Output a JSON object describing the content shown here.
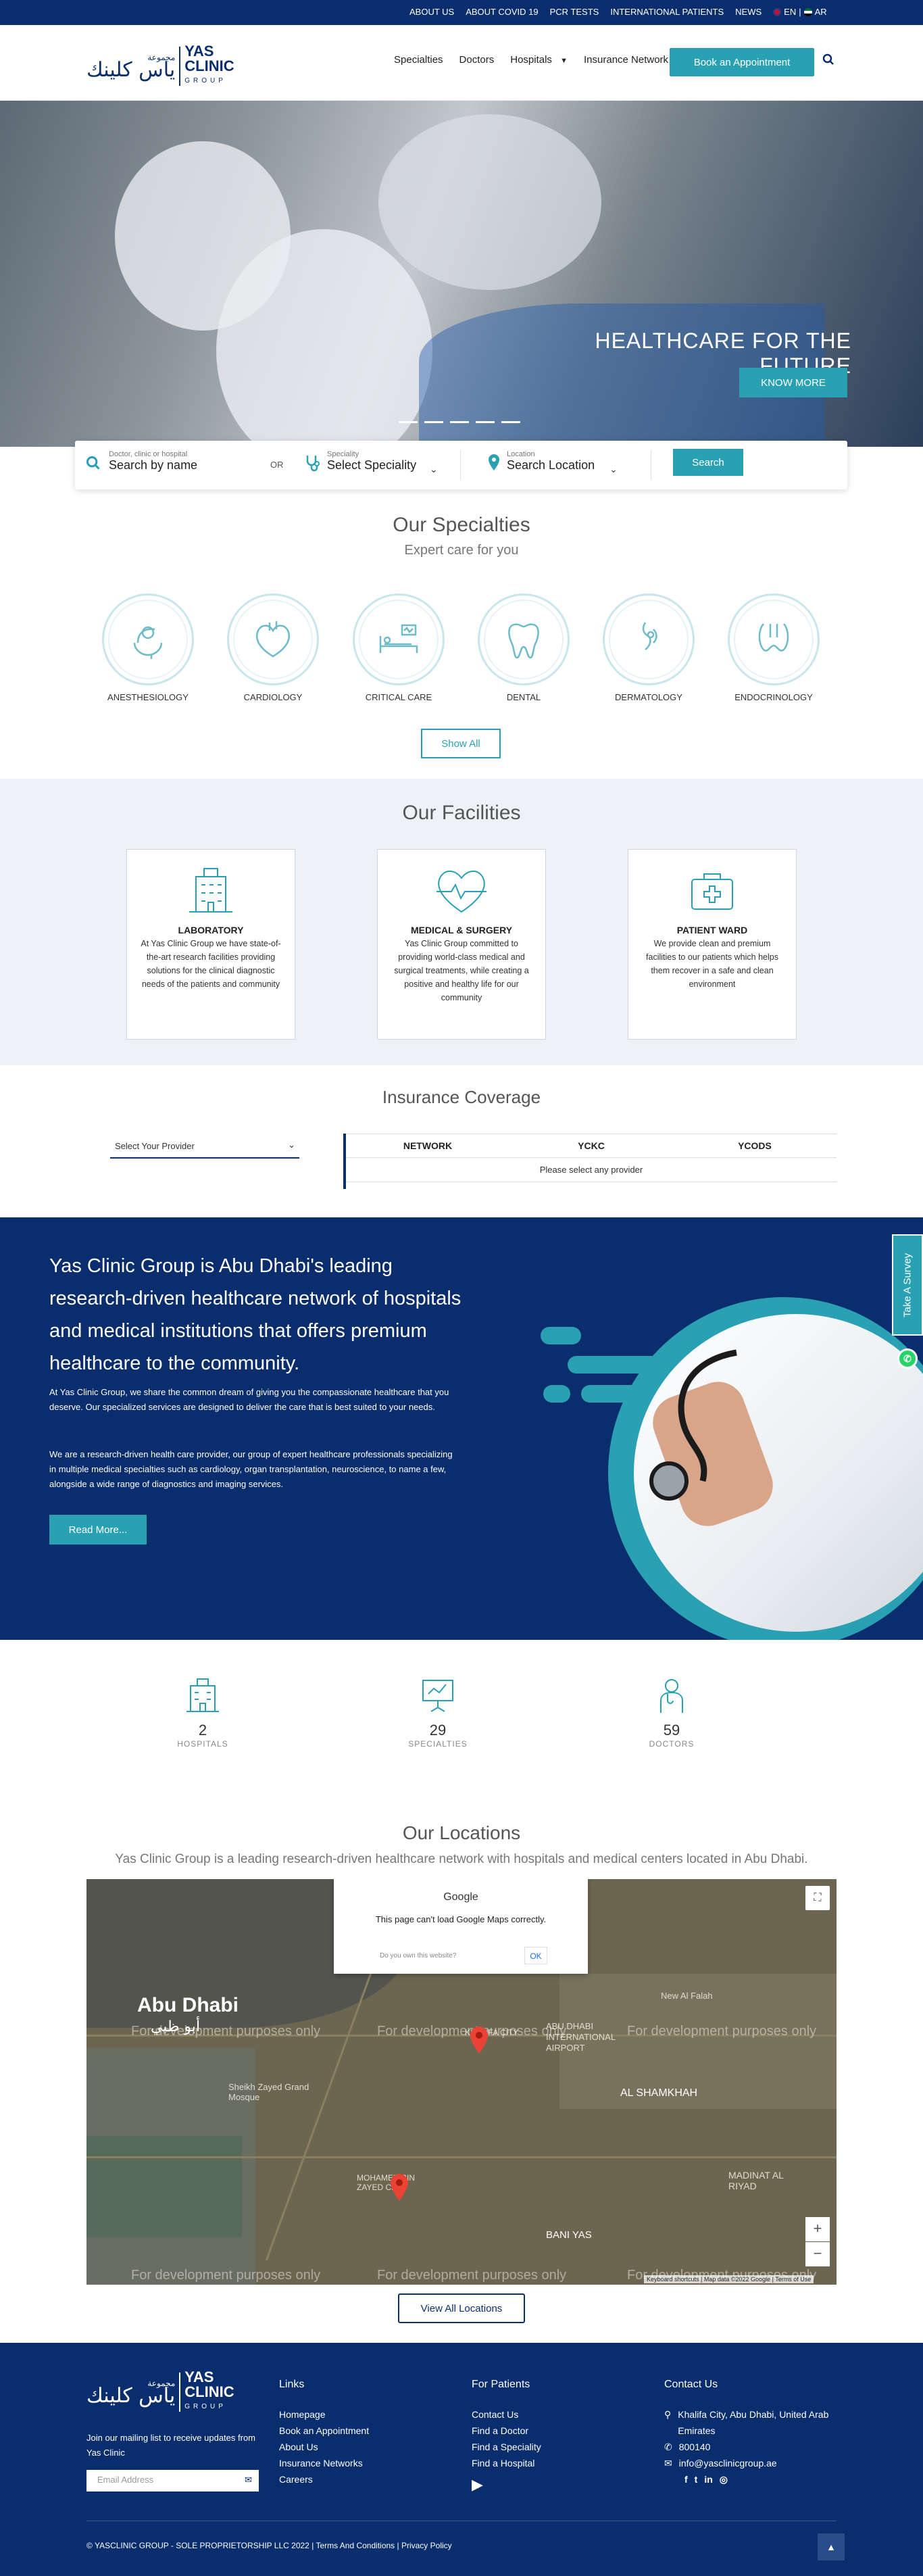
{
  "topbar": {
    "links": [
      "ABOUT US",
      "ABOUT COVID 19",
      "PCR TESTS",
      "INTERNATIONAL PATIENTS",
      "NEWS"
    ],
    "lang_en": "EN",
    "lang_sep": "|",
    "lang_ar": "AR"
  },
  "logo": {
    "ar_small": "مجموعة",
    "ar": "ياس كلينك",
    "en": "YAS CLINIC",
    "en_sub": "GROUP"
  },
  "nav": {
    "items": [
      "Specialties",
      "Doctors",
      "Hospitals",
      "Insurance Network"
    ],
    "book": "Book an Appointment"
  },
  "hero": {
    "title": "HEALTHCARE FOR THE FUTURE",
    "cta": "KNOW MORE",
    "slides": 5
  },
  "search": {
    "name_label": "Doctor, clinic or hospital",
    "name_placeholder": "Search by name",
    "or": "OR",
    "spec_label": "Speciality",
    "spec_value": "Select Speciality",
    "loc_label": "Location",
    "loc_value": "Search Location",
    "button": "Search"
  },
  "specialties": {
    "title": "Our Specialties",
    "subtitle": "Expert care for you",
    "items": [
      "ANESTHESIOLOGY",
      "CARDIOLOGY",
      "CRITICAL CARE",
      "DENTAL",
      "DERMATOLOGY",
      "ENDOCRINOLOGY"
    ],
    "show_all": "Show All"
  },
  "facilities": {
    "title": "Our Facilities",
    "items": [
      {
        "title": "LABORATORY",
        "text": "At Yas Clinic Group we have state-of-the-art research facilities providing solutions for the clinical diagnostic needs of the patients and community"
      },
      {
        "title": "MEDICAL & SURGERY",
        "text": "Yas Clinic Group committed to providing world-class medical and surgical treatments, while creating a positive and healthy life for our community"
      },
      {
        "title": "PATIENT WARD",
        "text": "We provide clean and premium facilities to our patients which helps them recover in a safe and clean environment"
      }
    ]
  },
  "insurance": {
    "title": "Insurance Coverage",
    "select": "Select Your Provider",
    "columns": [
      "NETWORK",
      "YCKC",
      "YCODS"
    ],
    "empty": "Please select any provider"
  },
  "about": {
    "headline": "Yas Clinic Group is Abu Dhabi's leading research-driven healthcare network of hospitals and medical institutions that offers premium healthcare to the community.",
    "p1": "At Yas Clinic Group, we share the common dream of giving you the compassionate healthcare that you deserve. Our specialized services are designed to deliver the care that is best suited to your needs.",
    "p2": "We are a research-driven health care provider, our group of expert healthcare professionals specializing in multiple medical specialties such as cardiology, organ transplantation, neuroscience, to name a few, alongside a wide range of diagnostics and imaging services.",
    "read_more": "Read More...",
    "survey": "Take A Survey"
  },
  "stats": [
    {
      "value": "2",
      "label": "HOSPITALS"
    },
    {
      "value": "29",
      "label": "SPECIALTIES"
    },
    {
      "value": "59",
      "label": "DOCTORS"
    }
  ],
  "locations": {
    "title": "Our Locations",
    "subtitle": "Yas Clinic Group is a leading research-driven healthcare network with hospitals and medical centers located in Abu Dhabi.",
    "dialog_title": "Google",
    "dialog_msg": "This page can't load Google Maps correctly.",
    "dialog_q": "Do you own this website?",
    "dialog_ok": "OK",
    "dev": "For development purposes only",
    "labels": [
      "Abu Dhabi",
      "أبو ظبي",
      "ABU DHABI INTERNATIONAL AIRPORT",
      "AL SHAMKHAH",
      "KHALIFA CITY",
      "BANI YAS",
      "MADINAT AL RIYAD",
      "MOHAMED BIN ZAYED CITY",
      "Sheikh Zayed Grand Mosque",
      "New Al Falah"
    ],
    "footer_text": "Keyboard shortcuts | Map data ©2022 Google | Terms of Use",
    "view_all": "View All Locations"
  },
  "footer": {
    "tagline": "Join our mailing list to receive updates from Yas Clinic",
    "email_placeholder": "Email Address",
    "links_title": "Links",
    "links": [
      "Homepage",
      "Book an Appointment",
      "About Us",
      "Insurance Networks",
      "Careers"
    ],
    "patients_title": "For Patients",
    "patients": [
      "Contact Us",
      "Find a Doctor",
      "Find a Speciality",
      "Find a Hospital"
    ],
    "contact_title": "Contact Us",
    "address": "Khalifa City, Abu Dhabi, United Arab Emirates",
    "phone": "800140",
    "email": "info@yasclinicgroup.ae",
    "copyright": "© YASCLINIC GROUP - SOLE PROPRIETORSHIP LLC 2022",
    "terms": "Terms And Conditions",
    "privacy": "Privacy Policy"
  },
  "colors": {
    "navy": "#0a2d6e",
    "teal": "#2aa1b3"
  }
}
